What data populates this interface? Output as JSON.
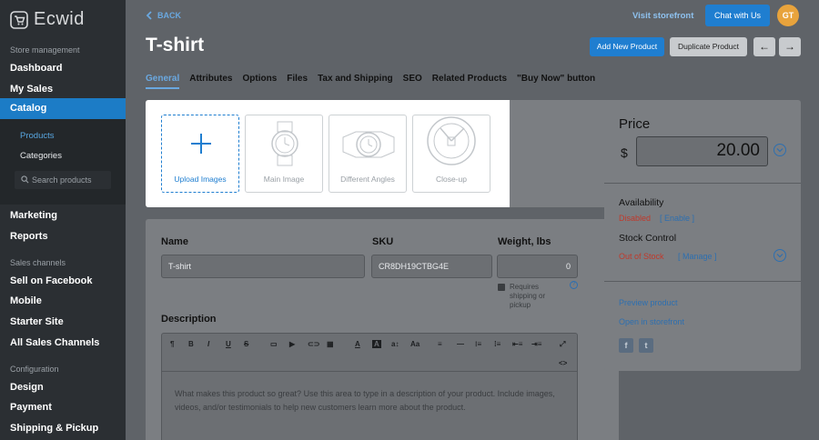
{
  "app": {
    "logo_text": "Ecwid"
  },
  "sidebar": {
    "sections": [
      {
        "label": "Store management"
      },
      {
        "label": "Sales channels"
      },
      {
        "label": "Configuration"
      }
    ],
    "items": {
      "dashboard": "Dashboard",
      "my_sales": "My Sales",
      "catalog": "Catalog",
      "marketing": "Marketing",
      "reports": "Reports",
      "sell_on_facebook": "Sell on Facebook",
      "mobile": "Mobile",
      "starter_site": "Starter Site",
      "all_sales_channels": "All Sales Channels",
      "design": "Design",
      "payment": "Payment",
      "shipping": "Shipping & Pickup"
    },
    "subitems": {
      "products": "Products",
      "categories": "Categories"
    },
    "search_placeholder": "Search products"
  },
  "header": {
    "back": "BACK",
    "title": "T-shirt",
    "visit_storefront": "Visit storefront",
    "chat": "Chat with Us",
    "avatar": "GT",
    "add_new_product": "Add New Product",
    "duplicate_product": "Duplicate Product",
    "prev_arrow": "←",
    "next_arrow": "→"
  },
  "tabs": [
    "General",
    "Attributes",
    "Options",
    "Files",
    "Tax and Shipping",
    "SEO",
    "Related Products",
    "\"Buy Now\" button"
  ],
  "images": {
    "upload": "Upload Images",
    "main": "Main Image",
    "angles": "Different Angles",
    "closeup": "Close-up"
  },
  "form": {
    "name_label": "Name",
    "name_value": "T-shirt",
    "sku_label": "SKU",
    "sku_value": "CR8DH19CTBG4E",
    "weight_label": "Weight, lbs",
    "weight_value": "0",
    "requires_shipping": "Requires shipping or pickup",
    "description_label": "Description",
    "description_placeholder": "What makes this product so great? Use this area to type in a description of your product. Include images, videos, and/or testimonials to help new customers learn more about the product.",
    "toolbar": [
      "¶",
      "B",
      "I",
      "U",
      "S",
      "▭",
      "▶",
      "⊂⊃",
      "▦",
      "A",
      "A",
      "a↕",
      "Aa",
      "≡",
      "—",
      "⁝≡",
      "⁞≡",
      "⇤≡",
      "⇥≡",
      "⤢",
      "<>"
    ]
  },
  "pricing": {
    "price_label": "Price",
    "currency": "$",
    "price_value": "20.00",
    "availability_label": "Availability",
    "availability_status": "Disabled",
    "availability_action": "[ Enable ]",
    "stock_label": "Stock Control",
    "stock_status": "Out of Stock",
    "stock_action": "[ Manage ]",
    "preview": "Preview product",
    "open_storefront": "Open in storefront"
  }
}
